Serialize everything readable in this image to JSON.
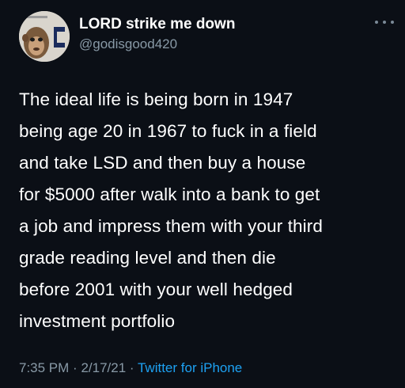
{
  "tweet": {
    "display_name": "LORD strike me down",
    "handle": "@godisgood420",
    "avatar_icon": "monkey-avatar-icon",
    "more_icon": "more-options-icon",
    "lines": [
      "The ideal life is being born in 1947",
      "being age 20 in 1967 to fuck in a field",
      "and take LSD and then buy a house",
      "for $5000 after walk into a bank to get",
      "a job and impress them with your third",
      "grade reading level and then die",
      "before 2001 with your well hedged",
      "investment portfolio"
    ],
    "time": "7:35 PM",
    "date": "2/17/21",
    "separator": "·",
    "source": "Twitter for iPhone"
  },
  "colors": {
    "background": "#0b0f16",
    "text": "#ffffff",
    "muted": "#8899a6",
    "link": "#1da1f2"
  }
}
